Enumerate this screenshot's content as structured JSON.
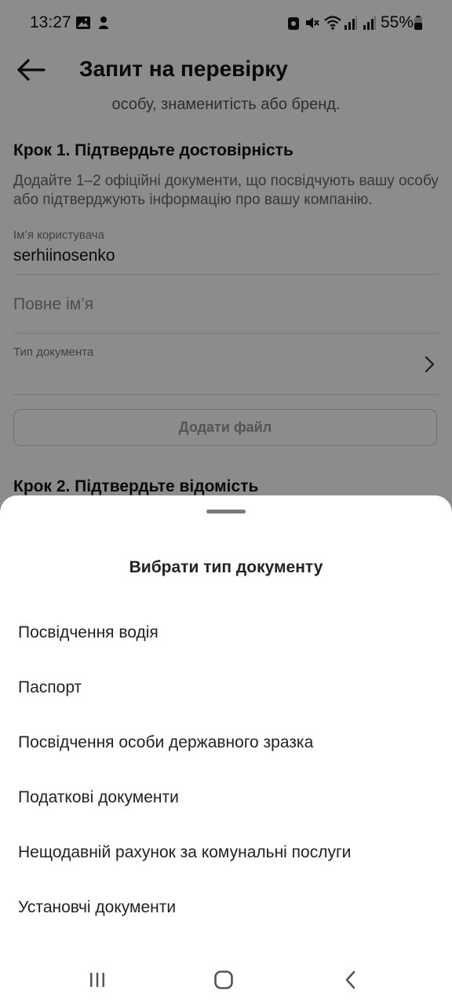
{
  "status_bar": {
    "time": "13:27",
    "battery": "55%",
    "icons": [
      "image-icon",
      "notification-icon",
      "alarm-icon",
      "mute-icon",
      "wifi-icon",
      "signal-icon",
      "signal-icon",
      "battery-icon"
    ]
  },
  "header": {
    "title": "Запит на перевірку",
    "back_icon": "arrow-left-icon"
  },
  "form": {
    "intro_tail": "особу, знаменитість або бренд.",
    "step1_title": "Крок 1. Підтвердьте достовірність",
    "step1_desc": "Додайте 1–2 офіційні документи, що посвідчують вашу особу або підтверджують інформацію про вашу компанію.",
    "username_label": "Ім’я користувача",
    "username_value": "serhiinosenko",
    "fullname_placeholder": "Повне ім’я",
    "doc_type_label": "Тип документа",
    "add_file_label": "Додати файл",
    "step2_title": "Крок 2. Підтвердьте відомість"
  },
  "sheet": {
    "title": "Вибрати тип документу",
    "options": [
      "Посвідчення водія",
      "Паспорт",
      "Посвідчення особи державного зразка",
      "Податкові документи",
      "Нещодавній рахунок за комунальні послуги",
      "Установчі документи"
    ]
  },
  "nav": {
    "recents": "recents-icon",
    "home": "home-icon",
    "back": "back-icon"
  }
}
